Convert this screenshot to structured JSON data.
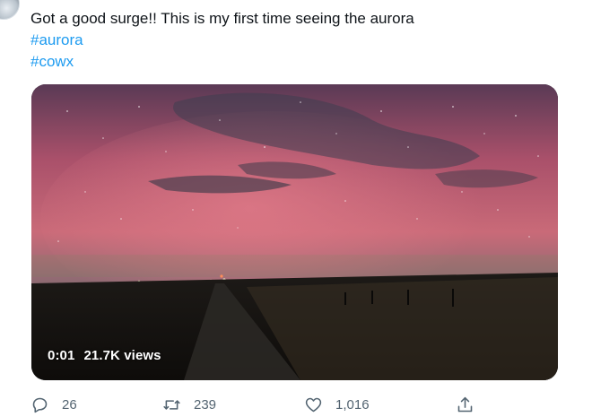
{
  "tweet": {
    "text": "Got a good surge!! This is my first time seeing the aurora",
    "hashtags": [
      "#aurora",
      "#cowx"
    ]
  },
  "media": {
    "type": "video",
    "description_icon": "video-thumbnail",
    "timestamp": "0:01",
    "views": "21.7K views"
  },
  "actions": {
    "reply_count": "26",
    "retweet_count": "239",
    "like_count": "1,016",
    "icons": [
      "reply-icon",
      "retweet-icon",
      "like-icon",
      "share-icon"
    ]
  },
  "colors": {
    "link": "#1d9bf0",
    "text": "#0f1419",
    "secondary": "#536471"
  }
}
